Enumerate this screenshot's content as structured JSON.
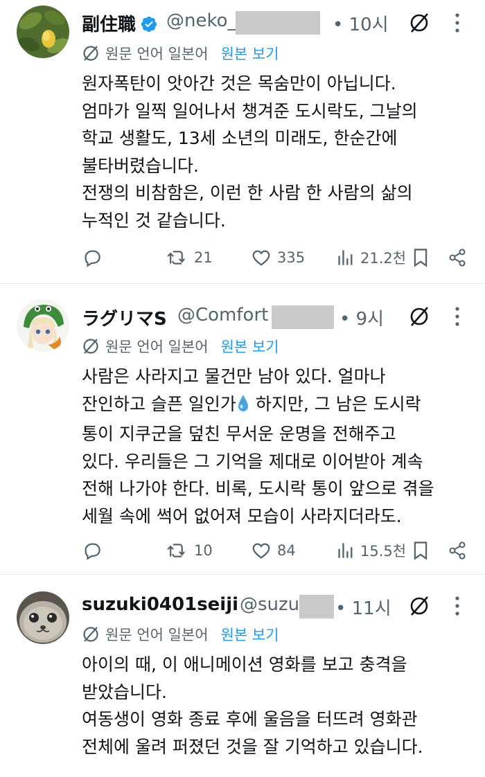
{
  "colors": {
    "text": "#0f1419",
    "secondary": "#536471",
    "link": "#1d9bf0",
    "verified": "#1d9bf0"
  },
  "tweets": [
    {
      "name": "副住職",
      "handle": "@neko_",
      "time": "10시",
      "verified": true,
      "translation_note": "원문 언어 일본어",
      "show_original": "원본 보기",
      "lines": [
        "원자폭탄이 앗아간 것은 목숨만이 아닙니다.",
        "엄마가 일찍 일어나서 챙겨준 도시락도, 그날의",
        "학교 생활도, 13세 소년의 미래도, 한순간에",
        "불타버렸습니다.",
        "전쟁의 비참함은, 이런 한 사람 한 사람의 삶의",
        "누적인 것 같습니다."
      ],
      "retweets": "21",
      "likes": "335",
      "views": "21.2천"
    },
    {
      "name": "ラグリマS",
      "handle": "@Comfort",
      "time": "9시",
      "verified": false,
      "translation_note": "원문 언어 일본어",
      "show_original": "원본 보기",
      "lines": [
        "사람은 사라지고 물건만 남아 있다. 얼마나",
        "잔인하고 슬픈 일인가",
        "통이 지쿠군을 덮친 무서운 운명을 전해주고",
        "있다. 우리들은 그 기억을 제대로 이어받아 계속",
        "전해 나가야 한다. 비록, 도시락 통이 앞으로 겪을",
        "세월 속에 썩어 없어져 모습이 사라지더라도."
      ],
      "line2_after_emoji": " 하지만, 그 남은 도시락",
      "retweets": "10",
      "likes": "84",
      "views": "15.5천"
    },
    {
      "name": "suzuki0401seiji",
      "handle": "@suzu",
      "time": "11시",
      "verified": false,
      "translation_note": "원문 언어 일본어",
      "show_original": "원본 보기",
      "lines": [
        "아이의 때, 이 애니메이션 영화를 보고 충격을",
        "받았습니다.",
        "여동생이 영화 종료 후에 울음을 터뜨려 영화관",
        "전체에 울려 퍼졌던 것을 잘 기억하고 있습니다."
      ]
    }
  ]
}
